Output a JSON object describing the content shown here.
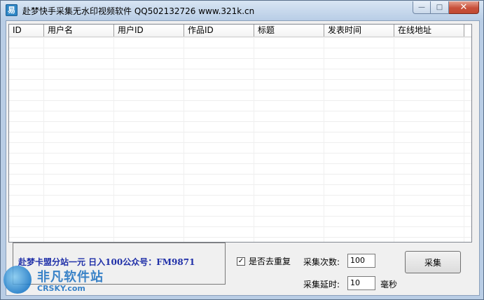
{
  "window": {
    "title": "赴梦快手采集无水印视频软件   QQ502132726   www.321k.cn",
    "icon_label": "易",
    "min_glyph": "—",
    "max_glyph": "□",
    "close_glyph": "✕"
  },
  "table": {
    "columns": [
      "ID",
      "用户名",
      "用户ID",
      "作品ID",
      "标题",
      "发表时间",
      "在线地址"
    ],
    "rows": []
  },
  "notice": {
    "text": "赴梦卡盟分站一元 日入100公众号：FM9871"
  },
  "options": {
    "dedupe_label": "是否去重复",
    "dedupe_checked": "✓",
    "count_label": "采集次数:",
    "count_value": "100",
    "delay_label": "采集延时:",
    "delay_value": "10",
    "delay_unit": "毫秒",
    "collect_button": "采集"
  },
  "watermark": {
    "cn": "非凡软件站",
    "en": "CRSKY.com"
  }
}
